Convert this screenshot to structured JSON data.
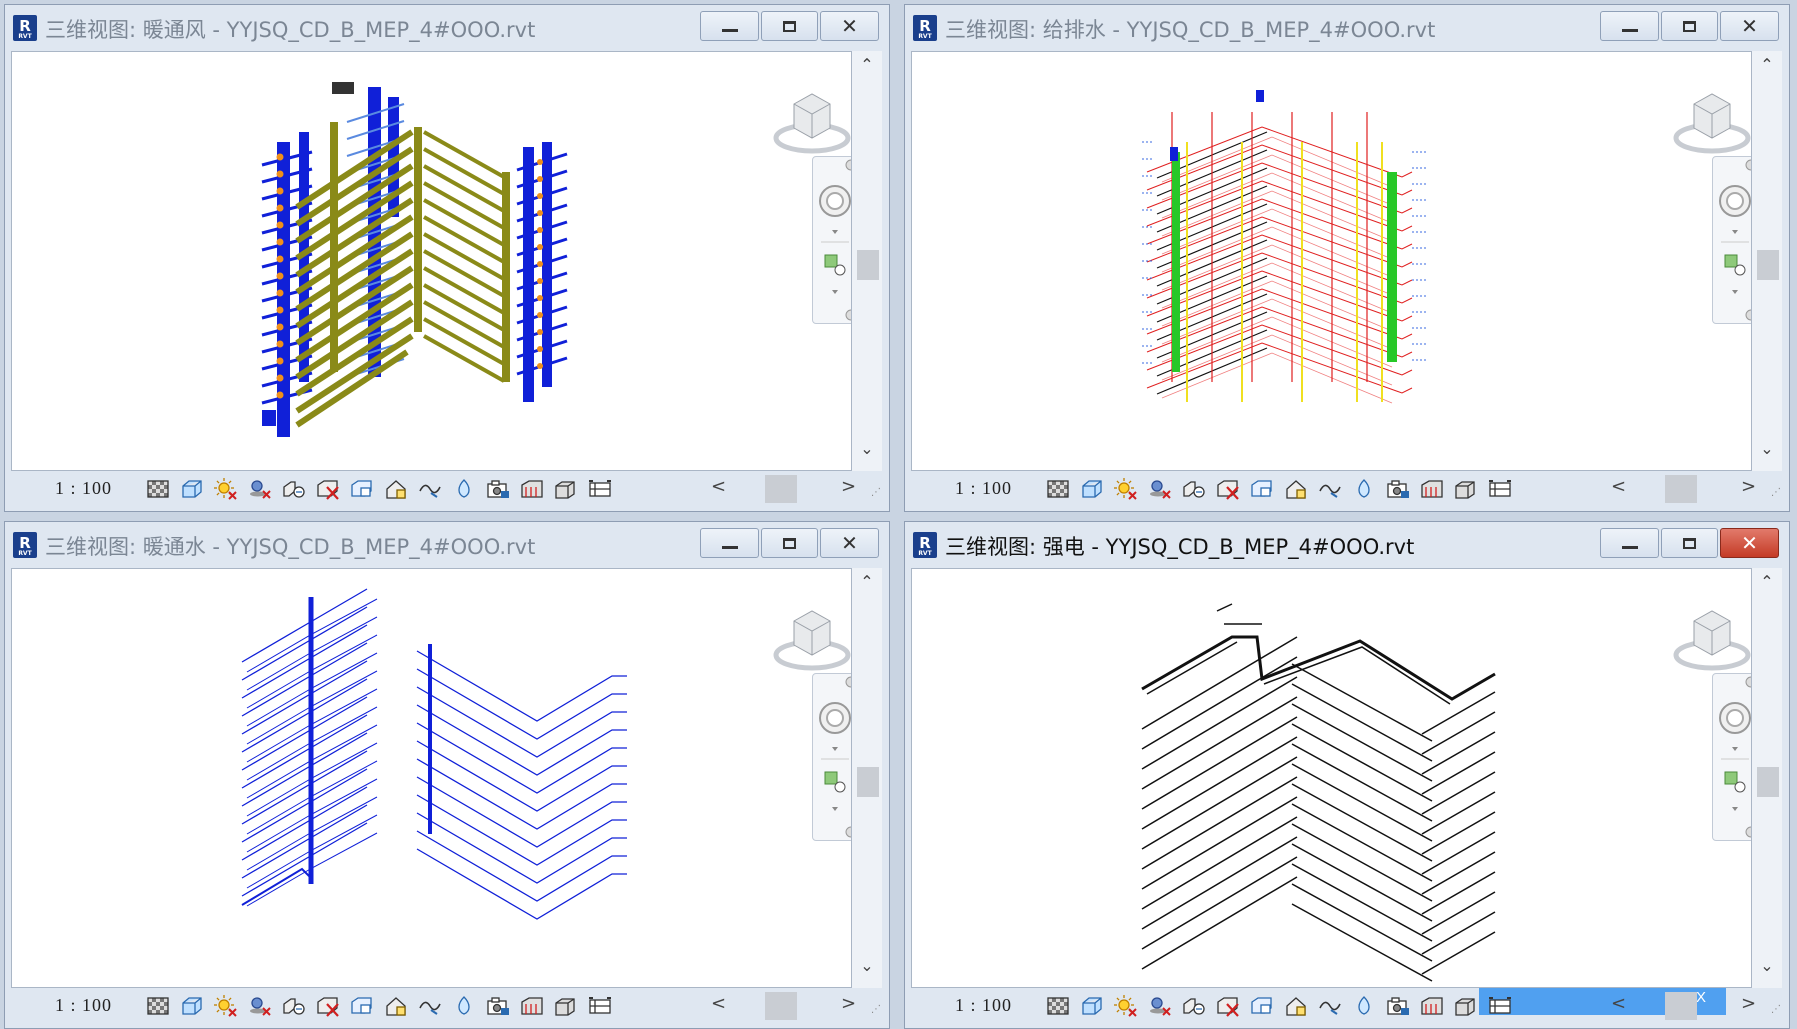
{
  "windows": [
    {
      "id": "w0",
      "title": "三维视图: 暖通风 - YYJSQ_CD_B_MEP_4#OOO.rvt",
      "active": false,
      "scale": "1 : 100",
      "model": "hvac-air-ducts"
    },
    {
      "id": "w1",
      "title": "三维视图: 给排水 - YYJSQ_CD_B_MEP_4#OOO.rvt",
      "active": false,
      "scale": "1 : 100",
      "model": "plumbing-piping"
    },
    {
      "id": "w2",
      "title": "三维视图: 暖通水 - YYJSQ_CD_B_MEP_4#OOO.rvt",
      "active": false,
      "scale": "1 : 100",
      "model": "hvac-water-piping"
    },
    {
      "id": "w3",
      "title": "三维视图: 强电 - YYJSQ_CD_B_MEP_4#OOO.rvt",
      "active": true,
      "scale": "1 : 100",
      "model": "electrical-cable-trays"
    }
  ],
  "app_icon": {
    "letter": "R",
    "sub": "RVT"
  },
  "scrollbar": {
    "up": "⌃",
    "down": "⌄",
    "left": "<",
    "right": ">"
  },
  "tooltip_close": "X",
  "view_control_icons": [
    "detail-level-icon",
    "visual-style-icon",
    "sun-path-icon",
    "shadows-icon",
    "render-icon",
    "crop-view-icon",
    "show-crop-region-icon",
    "unlock-3d-view-icon",
    "temporary-hide-icon",
    "reveal-hidden-icon",
    "worksharing-display-icon",
    "analysis-display-icon",
    "highlight-displacement-icon",
    "reveal-constraints-icon"
  ],
  "colors": {
    "hvac_blue": "#1020d8",
    "hvac_olive": "#8a8a18",
    "hvac_orange": "#f0901a",
    "plumbing_red": "#e02020",
    "plumbing_yellow": "#f0e020",
    "plumbing_green": "#28c828",
    "electrical_black": "#111111",
    "active_close": "#c43b26"
  }
}
